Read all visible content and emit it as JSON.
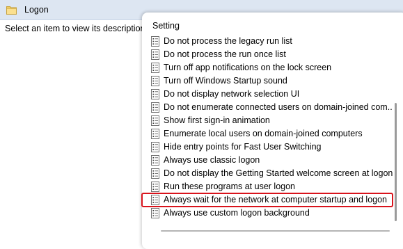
{
  "header": {
    "title": "Logon",
    "icon": "folder-icon"
  },
  "left_pane": {
    "description": "Select an item to view its description."
  },
  "list": {
    "column_header": "Setting",
    "item_icon": "policy-setting-icon",
    "highlight_color": "#d9131c",
    "items": [
      {
        "label": "Do not process the legacy run list"
      },
      {
        "label": "Do not process the run once list"
      },
      {
        "label": "Turn off app notifications on the lock screen"
      },
      {
        "label": "Turn off Windows Startup sound"
      },
      {
        "label": "Do not display network selection UI"
      },
      {
        "label": "Do not enumerate connected users on domain-joined com..."
      },
      {
        "label": "Show first sign-in animation"
      },
      {
        "label": "Enumerate local users on domain-joined computers"
      },
      {
        "label": "Hide entry points for Fast User Switching"
      },
      {
        "label": "Always use classic logon"
      },
      {
        "label": "Do not display the Getting Started welcome screen at logon"
      },
      {
        "label": "Run these programs at user logon"
      },
      {
        "label": "Always wait for the network at computer startup and logon",
        "highlighted": true
      },
      {
        "label": "Always use custom logon background"
      }
    ]
  }
}
